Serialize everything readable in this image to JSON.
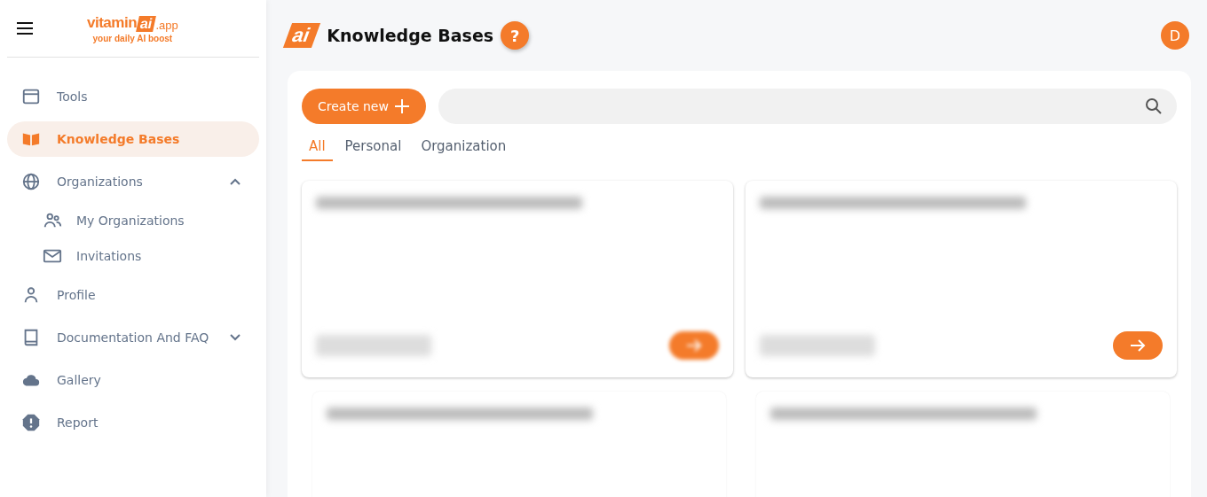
{
  "sidebar": {
    "logo": {
      "word": "vitamin",
      "mark": "ai",
      "suffix": ".app",
      "tagline": "your daily AI boost"
    },
    "items": [
      {
        "label": "Tools",
        "kind": "window",
        "selected": false
      },
      {
        "label": "Knowledge Bases",
        "kind": "book",
        "selected": true
      },
      {
        "label": "Organizations",
        "kind": "globe",
        "selected": false,
        "expanded": true,
        "children": [
          {
            "label": "My Organizations",
            "kind": "people",
            "selected": false
          },
          {
            "label": "Invitations",
            "kind": "mail",
            "selected": false
          }
        ]
      },
      {
        "label": "Profile",
        "kind": "person",
        "selected": false
      },
      {
        "label": "Documentation And FAQ",
        "kind": "manual",
        "selected": false,
        "expanded": false
      },
      {
        "label": "Gallery",
        "kind": "cloud",
        "selected": false
      },
      {
        "label": "Report",
        "kind": "alert",
        "selected": false
      }
    ]
  },
  "header": {
    "logo_mark": "ai",
    "title": "Knowledge Bases",
    "help": "?",
    "avatar": "D"
  },
  "toolbar": {
    "create_button": "Create new"
  },
  "tabs": [
    {
      "label": "All",
      "selected": true
    },
    {
      "label": "Personal",
      "selected": false
    },
    {
      "label": "Organization",
      "selected": false
    }
  ],
  "cards": [
    {
      "kind": "full",
      "button_blurred": true
    },
    {
      "kind": "full",
      "button_blurred": false
    },
    {
      "kind": "title"
    },
    {
      "kind": "title"
    }
  ]
}
